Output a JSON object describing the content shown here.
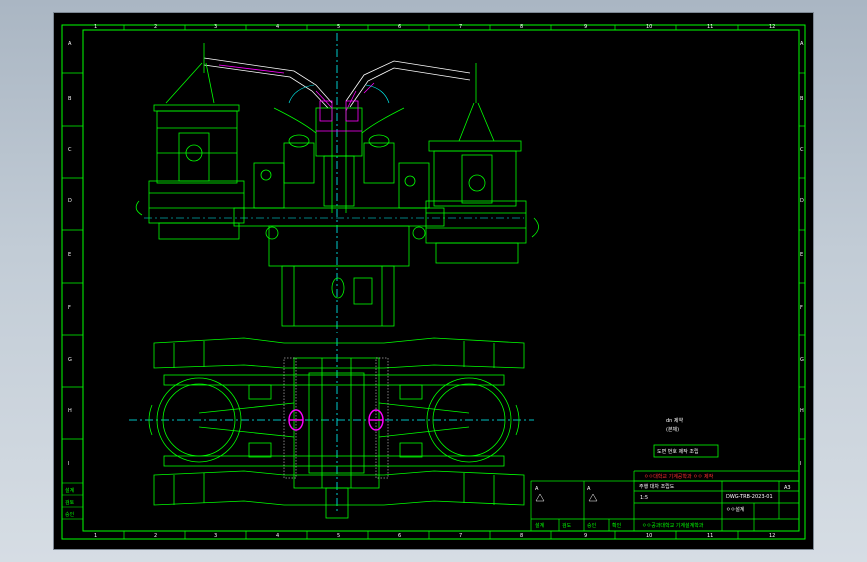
{
  "drawing": {
    "columns": [
      "1",
      "2",
      "3",
      "4",
      "5",
      "6",
      "7",
      "8",
      "9",
      "10",
      "11",
      "12"
    ],
    "rows": [
      "A",
      "B",
      "C",
      "D",
      "E",
      "F",
      "G",
      "H",
      "I"
    ],
    "notes": {
      "line1": "dn 제약",
      "line2": "(본체)",
      "line3": "도면 번호 제작 조립"
    },
    "title_block": {
      "header": "ㅇㅇ대학교 기계공학과 ㅇㅇ 제작",
      "name": "주행 대차 조립도",
      "drawing_no": "DWG-TRB-2023-01",
      "scale": "1:5",
      "sheet": "A3",
      "check_marks": [
        "A",
        "A"
      ],
      "school": "ㅇㅇ공과대학교 기계설계학과",
      "sub": "ㅇㅇ설계",
      "signatures": [
        "설계",
        "검도",
        "승인",
        "확인"
      ],
      "left_labels": [
        "설계",
        "검토",
        "승인"
      ]
    }
  },
  "colors": {
    "background": "#000000",
    "frame": "#00ff00",
    "machine": "#00ff00",
    "highlight": "#ff00ff",
    "centerline": "#00ffff",
    "text": "#ffffff",
    "title": "#ff0000",
    "desktop": "#b7c2cd"
  }
}
